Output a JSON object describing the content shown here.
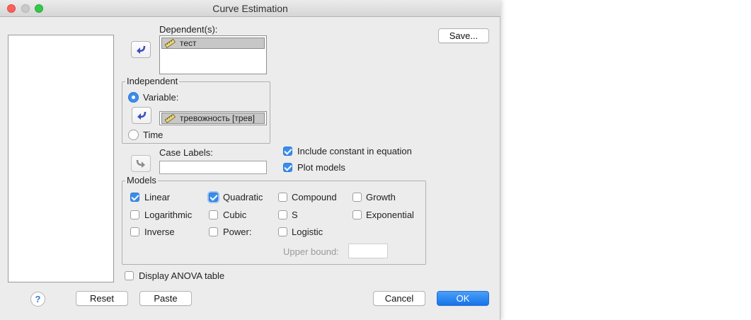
{
  "window": {
    "title": "Curve Estimation"
  },
  "dependents": {
    "label": "Dependent(s):",
    "items": [
      "тест"
    ]
  },
  "independent": {
    "group_title": "Independent",
    "variable_label": "Variable:",
    "variable_value": "тревожность [трев]",
    "time_label": "Time"
  },
  "case_labels": {
    "label": "Case Labels:",
    "value": ""
  },
  "options": {
    "include_constant": "Include constant in equation",
    "plot_models": "Plot models"
  },
  "models": {
    "group_title": "Models",
    "linear": "Linear",
    "quadratic": "Quadratic",
    "compound": "Compound",
    "growth": "Growth",
    "logarithmic": "Logarithmic",
    "cubic": "Cubic",
    "s": "S",
    "exponential": "Exponential",
    "inverse": "Inverse",
    "power": "Power:",
    "logistic": "Logistic",
    "upper_bound_label": "Upper bound:",
    "upper_bound_value": ""
  },
  "display_anova": "Display ANOVA table",
  "buttons": {
    "save": "Save...",
    "help": "?",
    "reset": "Reset",
    "paste": "Paste",
    "cancel": "Cancel",
    "ok": "OK"
  },
  "colors": {
    "accent": "#3b8dea",
    "ok_button": "#1773ea"
  },
  "icons": {
    "move_arrow": "curved-arrow-icon",
    "scale_variable": "ruler-icon"
  }
}
